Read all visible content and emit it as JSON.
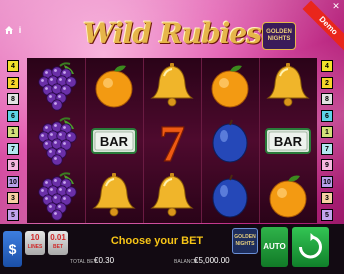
{
  "header": {
    "title": "Wild Rubies",
    "badge_line1": "GOLDEN",
    "badge_line2": "NIGHTS",
    "demo_label": "Demo"
  },
  "paylines_left": [
    "4",
    "2",
    "8",
    "6",
    "1",
    "7",
    "9",
    "10",
    "3",
    "5"
  ],
  "paylines_right": [
    "4",
    "2",
    "8",
    "6",
    "1",
    "7",
    "9",
    "10",
    "3",
    "5"
  ],
  "payline_colors": [
    "#f2e12c",
    "#f6d52a",
    "#e2e2e2",
    "#5ed4e8",
    "#d3e07a",
    "#b3e6f0",
    "#f5b7df",
    "#b7a1e8",
    "#f6d0a2",
    "#c2a4ec"
  ],
  "reels": [
    [
      "grapes",
      "grapes",
      "grapes"
    ],
    [
      "orange",
      "bar",
      "bell"
    ],
    [
      "bell",
      "seven",
      "bell"
    ],
    [
      "orange",
      "plum",
      "plum"
    ],
    [
      "bell",
      "bar",
      "orange"
    ]
  ],
  "symbols": {
    "bar_label": "BAR",
    "seven_label": "7"
  },
  "bottom": {
    "currency_icon": "$",
    "lines_value": "10",
    "lines_label": "LINES",
    "bet_value": "0.01",
    "bet_label": "BET",
    "choose_text": "Choose your BET",
    "total_bet_label": "TOTAL BET",
    "total_bet_value": "€0.30",
    "balance_label": "BALANCE",
    "balance_value": "€5,000.00",
    "gn_line1": "GOLDEN",
    "gn_line2": "NIGHTS",
    "auto_label": "AUTO"
  },
  "colors": {
    "accent_gold": "#e6b64a",
    "choose_text": "#f7c516",
    "spin_green": "#2fb34a",
    "demo_red": "#e9261c"
  }
}
